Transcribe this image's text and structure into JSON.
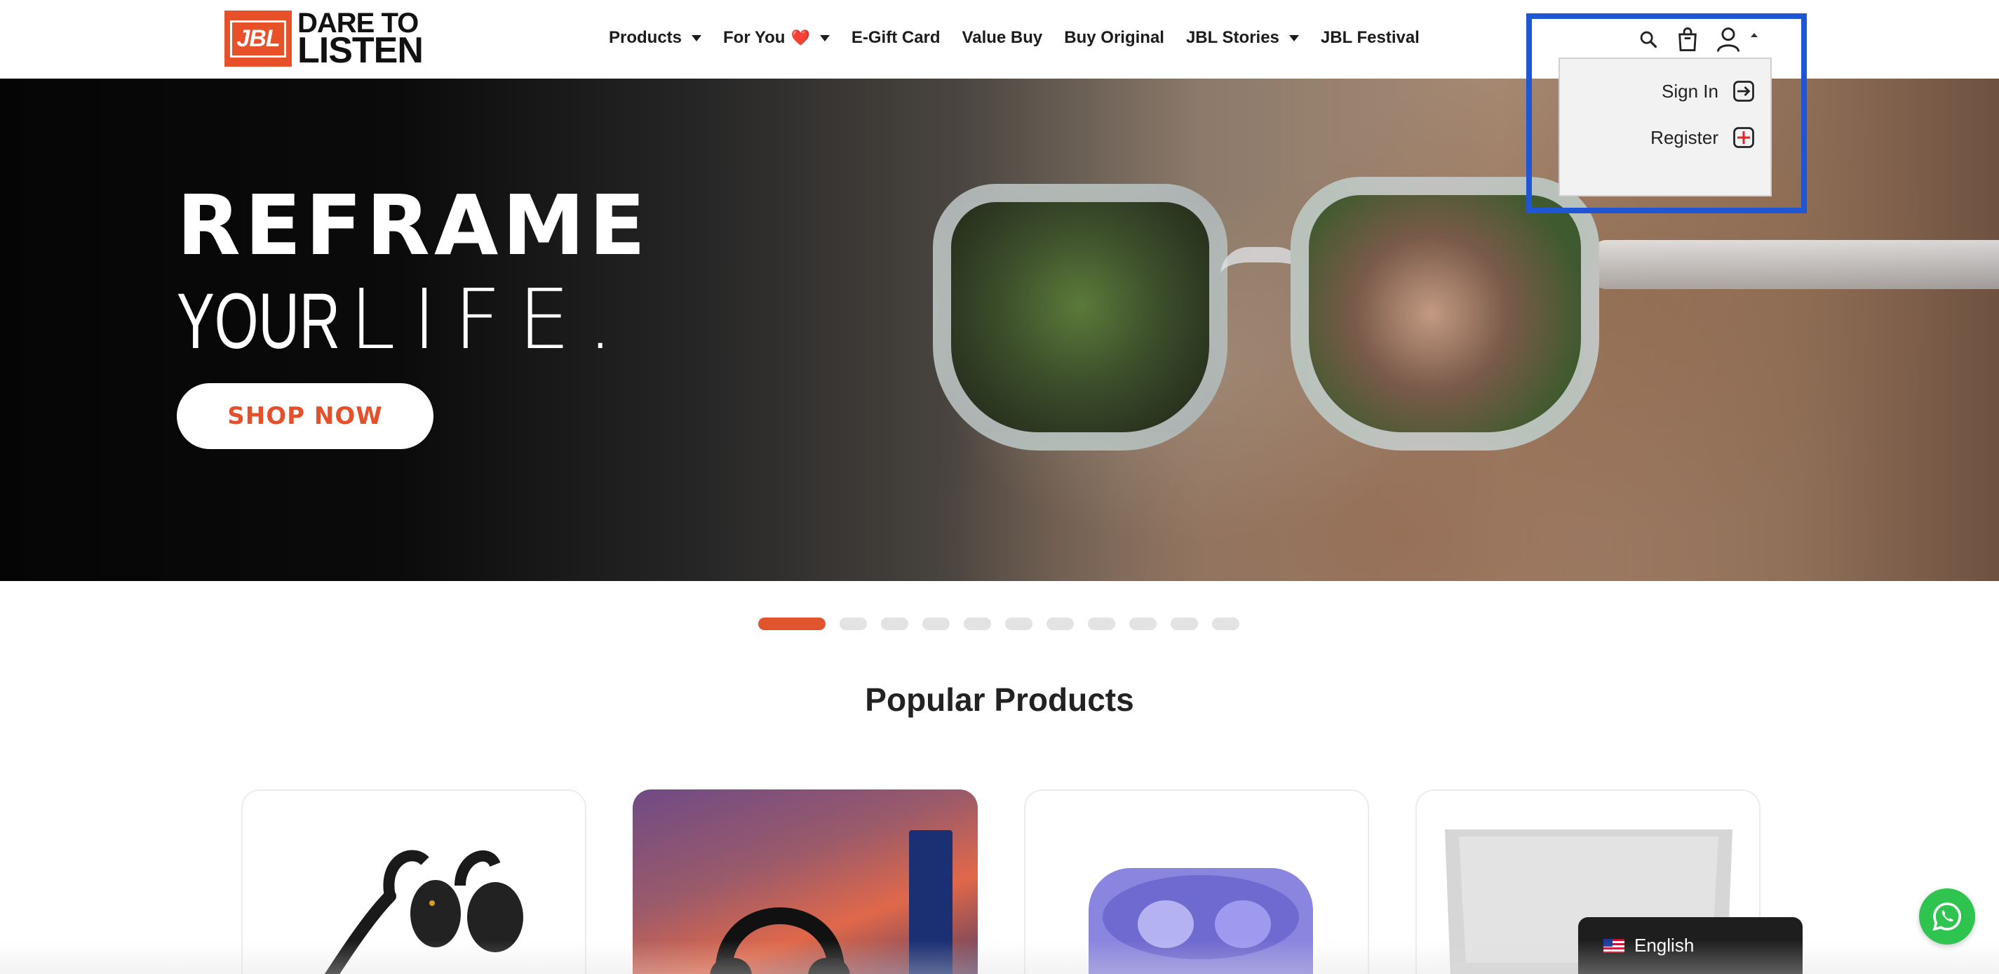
{
  "header": {
    "logo": {
      "brand": "JBL",
      "tagline_line1": "DARE TO",
      "tagline_line2": "LISTEN"
    },
    "nav": [
      {
        "label": "Products",
        "has_dropdown": true
      },
      {
        "label": "For You",
        "emoji": "❤️",
        "has_dropdown": true
      },
      {
        "label": "E-Gift Card",
        "has_dropdown": false
      },
      {
        "label": "Value Buy",
        "has_dropdown": false
      },
      {
        "label": "Buy Original",
        "has_dropdown": false
      },
      {
        "label": "JBL Stories",
        "has_dropdown": true
      },
      {
        "label": "JBL Festival",
        "has_dropdown": false
      }
    ],
    "icons": [
      "search-icon",
      "shopping-bag-icon",
      "user-icon",
      "caret-up-icon"
    ]
  },
  "account_menu": {
    "open": true,
    "items": [
      {
        "label": "Sign In",
        "icon": "sign-in-icon"
      },
      {
        "label": "Register",
        "icon": "register-icon"
      }
    ],
    "highlight_color": "#1f56d6"
  },
  "hero": {
    "title_line1": "REFRAME",
    "title_line2_a": "YOUR",
    "title_line2_b": "LIFE.",
    "cta_label": "SHOP NOW",
    "cta_color": "#e5502a"
  },
  "carousel": {
    "slide_count": 11,
    "active_index": 0,
    "active_color": "#e0552d"
  },
  "popular": {
    "title": "Popular Products",
    "products": [
      {
        "name": "open-ear-earbuds"
      },
      {
        "name": "over-ear-headphones"
      },
      {
        "name": "true-wireless-earbuds-case"
      },
      {
        "name": "turntable"
      }
    ]
  },
  "language": {
    "label": "English",
    "flag": "us-flag-icon"
  },
  "whatsapp": {
    "icon": "whatsapp-icon",
    "color": "#2fc34f"
  },
  "colors": {
    "brand": "#e8502a",
    "text": "#1c1c1c"
  }
}
